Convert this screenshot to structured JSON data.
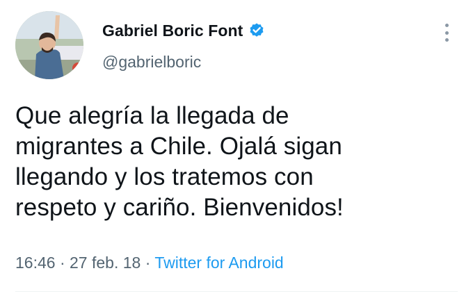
{
  "author": {
    "display_name": "Gabriel Boric Font",
    "handle": "@gabrielboric",
    "verified": true,
    "avatar_icon": "profile-photo"
  },
  "tweet": {
    "text": "Que alegría la llegada de migrantes a Chile. Ojalá sigan llegando y los tratemos con respeto y cariño. Bienvenidos!",
    "lines": [
      "Que alegría la llegada de",
      "migrantes a Chile. Ojalá sigan",
      "llegando y los tratemos con",
      "respeto y cariño. Bienvenidos!"
    ],
    "time": "16:46",
    "separator": " · ",
    "date": "27 feb. 18",
    "source": "Twitter for Android"
  },
  "icons": {
    "verified": "verified-badge-icon",
    "more": "more-options-icon"
  },
  "colors": {
    "accent": "#1d9bf0",
    "text_primary": "#0f1419",
    "text_secondary": "#536471"
  }
}
